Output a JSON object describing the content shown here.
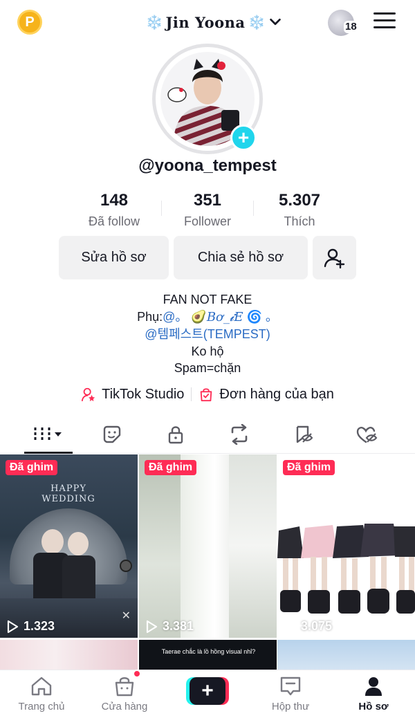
{
  "topbar": {
    "coin_letter": "P",
    "account_name": "Jin Yoona",
    "flake": "❄️",
    "notification_count": "18"
  },
  "profile": {
    "username": "@yoona_tempest",
    "stats": [
      {
        "value": "148",
        "label": "Đã follow"
      },
      {
        "value": "351",
        "label": "Follower"
      },
      {
        "value": "5.307",
        "label": "Thích"
      }
    ],
    "buttons": {
      "edit": "Sửa hồ sơ",
      "share": "Chia sẻ hồ sơ"
    },
    "bio": {
      "line1": "FAN NOT FAKE",
      "line2_prefix": "Phụ:",
      "line2_handle": "@。",
      "line2_avocado": "🥑",
      "line2_name": "Bơ_𝓲𝐸",
      "line2_swirl": "🌀",
      "line2_suffix": "。",
      "line3": "@템페스트(TEMPEST)",
      "line4": "Ko hộ",
      "line5": "Spam=chặn"
    },
    "links": {
      "studio": "TikTok Studio",
      "orders": "Đơn hàng của bạn"
    }
  },
  "grid": {
    "pinned_label": "Đã ghim",
    "videos": [
      {
        "views": "1.323",
        "caption": "HAPPY WEDDING"
      },
      {
        "views": "3.381"
      },
      {
        "views": "3.075"
      }
    ],
    "row2_caption": "Taerae chắc là lồ hồng visual nhỉ?"
  },
  "bottomnav": {
    "home": "Trang chủ",
    "shop": "Cửa hàng",
    "inbox": "Hộp thư",
    "profile": "Hồ sơ"
  },
  "colors": {
    "accent_red": "#fe2c55",
    "accent_cyan": "#25f4ee",
    "plus_badge": "#20d5ec",
    "link_blue": "#2b6cc4"
  }
}
